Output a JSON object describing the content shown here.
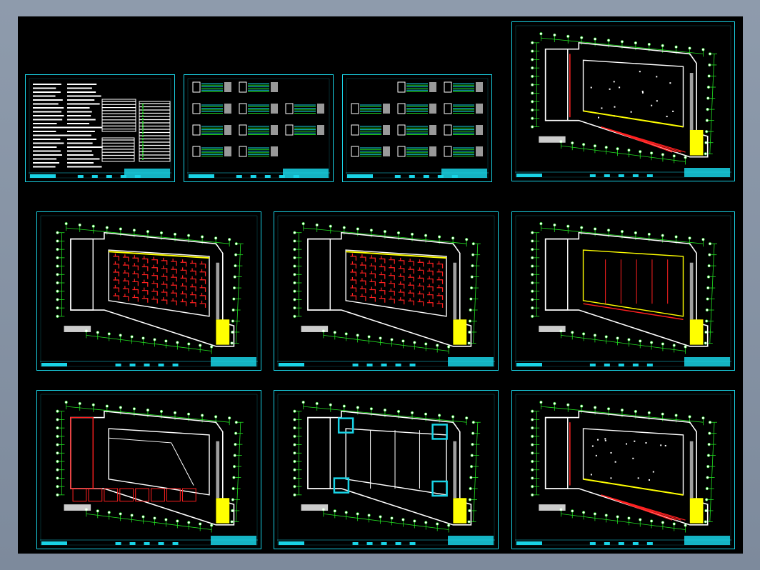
{
  "viewer": {
    "background_color": "#000000",
    "frame_color": "#19d3e6"
  },
  "colors": {
    "dimension": "#22e022",
    "wall": "#ffffff",
    "accent": "#ffff00",
    "circuit": "#ff2020",
    "frame": "#19d3e6",
    "fill_gray": "#a0a0a0"
  },
  "sheets": [
    {
      "kind": "notes"
    },
    {
      "kind": "schematic"
    },
    {
      "kind": "schematic"
    },
    {
      "kind": "plan-sparse"
    },
    {
      "kind": "plan-dense"
    },
    {
      "kind": "plan-dense"
    },
    {
      "kind": "plan-yellow"
    },
    {
      "kind": "plan-roof"
    },
    {
      "kind": "plan-grid"
    },
    {
      "kind": "plan-sparse"
    }
  ]
}
